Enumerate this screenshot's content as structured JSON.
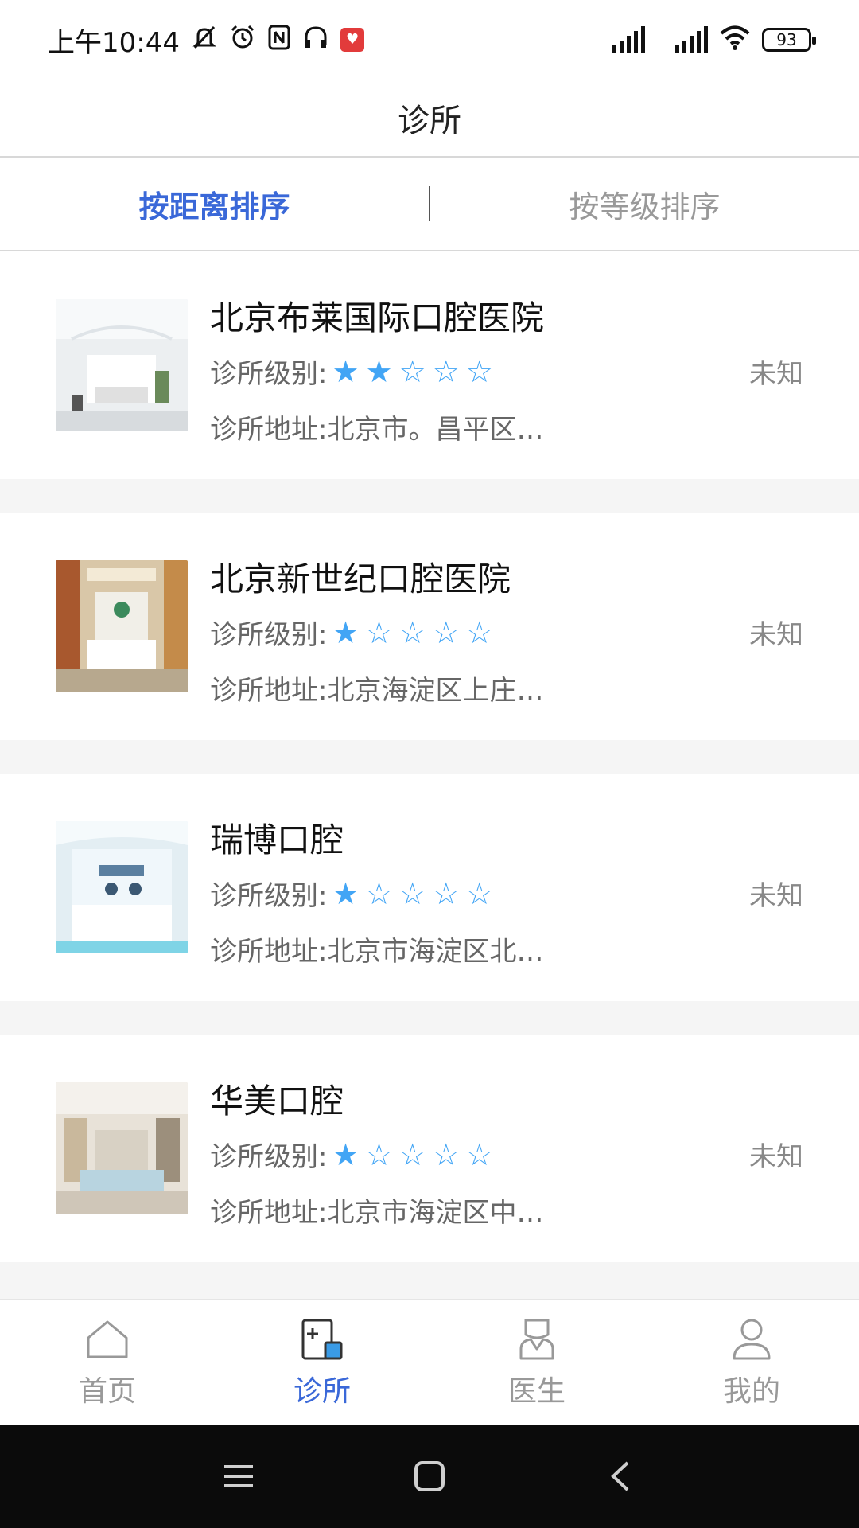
{
  "status_bar": {
    "time": "上午10:44",
    "battery": "93"
  },
  "header": {
    "title": "诊所"
  },
  "sort_tabs": [
    {
      "label": "按距离排序",
      "active": true
    },
    {
      "label": "按等级排序",
      "active": false
    }
  ],
  "clinics": [
    {
      "name": "北京布莱国际口腔医院",
      "level_label": "诊所级别:",
      "rating": 2,
      "max_rating": 5,
      "address": "诊所地址:北京市。昌平区…",
      "distance": "未知"
    },
    {
      "name": "北京新世纪口腔医院",
      "level_label": "诊所级别:",
      "rating": 1,
      "max_rating": 5,
      "address": "诊所地址:北京海淀区上庄…",
      "distance": "未知"
    },
    {
      "name": "瑞博口腔",
      "level_label": "诊所级别:",
      "rating": 1,
      "max_rating": 5,
      "address": "诊所地址:北京市海淀区北…",
      "distance": "未知"
    },
    {
      "name": "华美口腔",
      "level_label": "诊所级别:",
      "rating": 1,
      "max_rating": 5,
      "address": "诊所地址:北京市海淀区中…",
      "distance": "未知"
    }
  ],
  "bottom_nav": [
    {
      "label": "首页",
      "icon": "home-icon",
      "active": false
    },
    {
      "label": "诊所",
      "icon": "clinic-icon",
      "active": true
    },
    {
      "label": "医生",
      "icon": "doctor-icon",
      "active": false
    },
    {
      "label": "我的",
      "icon": "profile-icon",
      "active": false
    }
  ],
  "colors": {
    "accent": "#3a68d8",
    "star": "#42a5f5",
    "muted": "#999999"
  }
}
